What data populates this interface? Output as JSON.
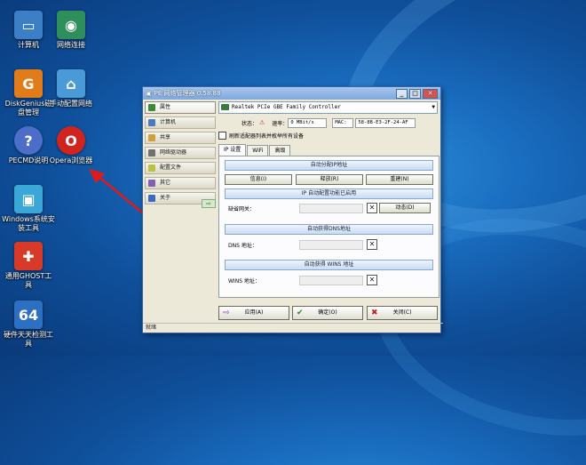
{
  "desktop": {
    "icons": [
      {
        "label": "计算机",
        "glyph": "▭",
        "color": "#3d7fc6",
        "icon": "computer-icon"
      },
      {
        "label": "网络连接",
        "glyph": "◉",
        "color": "#2f8f5c",
        "icon": "network-icon"
      },
      {
        "label": "DiskGenius磁盘管理",
        "glyph": "G",
        "color": "#e07d1a",
        "icon": "diskgenius-icon"
      },
      {
        "label": "手动配置网络",
        "glyph": "⌂",
        "color": "#4b9ad8",
        "icon": "network-config-icon"
      },
      {
        "label": "PECMD说明",
        "glyph": "?",
        "color": "#4d6ec8",
        "icon": "help-icon"
      },
      {
        "label": "Opera浏览器",
        "glyph": "O",
        "color": "#d0251e",
        "icon": "opera-icon"
      },
      {
        "label": "Windows系统安装工具",
        "glyph": "▣",
        "color": "#3aa7d6",
        "icon": "windows-install-icon"
      },
      {
        "label": "通用GHOST工具",
        "glyph": "✚",
        "color": "#d83a2a",
        "icon": "ghost-icon"
      },
      {
        "label": "硬件天天检测工具",
        "glyph": "64",
        "color": "#2d6fc0",
        "icon": "hardware-icon"
      }
    ]
  },
  "window": {
    "title": "PE 网络管理器 0.58.88",
    "nav": [
      "属性",
      "计算机",
      "共享",
      "网络驱动器",
      "配置文件",
      "其它",
      "关于"
    ],
    "nav_arrow": "⇨",
    "adapter": "Realtek PCIe GBE Family Controller",
    "status_label": "状态：",
    "speed_label": "速率：",
    "speed_value": "0 MBit/s",
    "mac_label": "MAC:",
    "mac_value": "58-8B-E3-2F-24-AF",
    "refresh_label": "刷新适配器列表并枚举所有设备",
    "tabs": [
      "IP 设置",
      "WiFi",
      "高级"
    ],
    "bar_auto_ip": "自动分配IP地址",
    "btn_info": "信息(I)",
    "btn_release": "释放(R)",
    "btn_renew": "重建(N)",
    "bar_ip_auto": "IP 自动配置功能已启用",
    "gateway_label": "缺省网关：",
    "btn_dynamic": "动态(D)",
    "bar_dns": "自动获得DNS地址",
    "dns_label": "DNS 地址：",
    "bar_wins": "自动获得 WINS 地址",
    "wins_label": "WINS 地址：",
    "btn_apply": "应用(A)",
    "btn_ok": "确定(O)",
    "btn_close": "关闭(C)",
    "status_text": "就绪"
  }
}
